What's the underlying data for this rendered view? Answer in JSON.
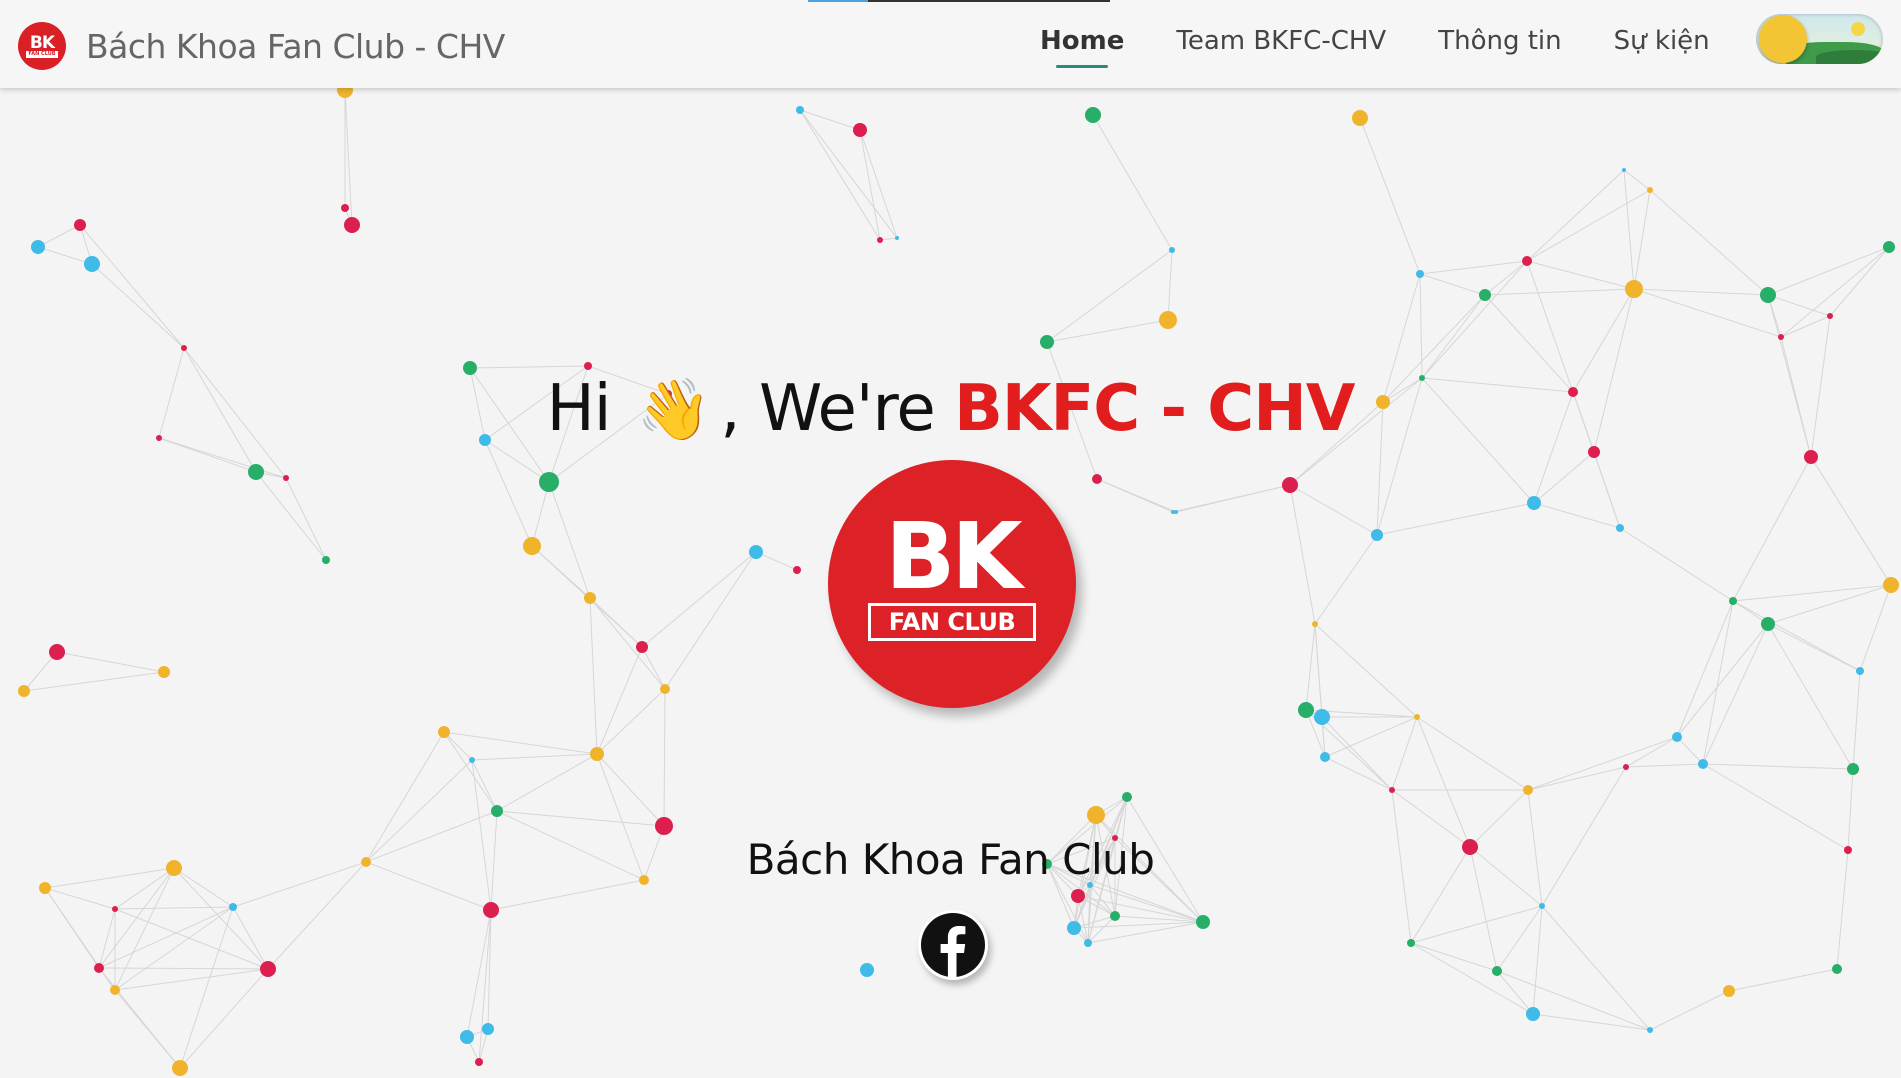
{
  "brand": {
    "logo_text": "BK",
    "logo_sub": "FAN CLUB",
    "title": "Bách Khoa Fan Club - CHV"
  },
  "nav": {
    "items": [
      {
        "label": "Home",
        "active": true
      },
      {
        "label": "Team BKFC-CHV",
        "active": false
      },
      {
        "label": "Thông tin",
        "active": false
      },
      {
        "label": "Sự kiện",
        "active": false
      }
    ]
  },
  "theme_toggle": {
    "state": "light"
  },
  "hero": {
    "greeting": "Hi",
    "wave_emoji": "👋",
    "prefix": ", We're ",
    "highlight": "BKFC - CHV"
  },
  "logo": {
    "big": "BK",
    "ribbon": "FAN CLUB"
  },
  "club_name": "Bách Khoa Fan Club",
  "social": {
    "icon": "facebook-icon"
  },
  "colors": {
    "brand_red": "#e21d1d",
    "nav_underline": "#2b8a7e",
    "dot_red": "#dc1f4e",
    "dot_blue": "#3fbbe8",
    "dot_green": "#27ae68",
    "dot_yellow": "#f0b42c"
  }
}
